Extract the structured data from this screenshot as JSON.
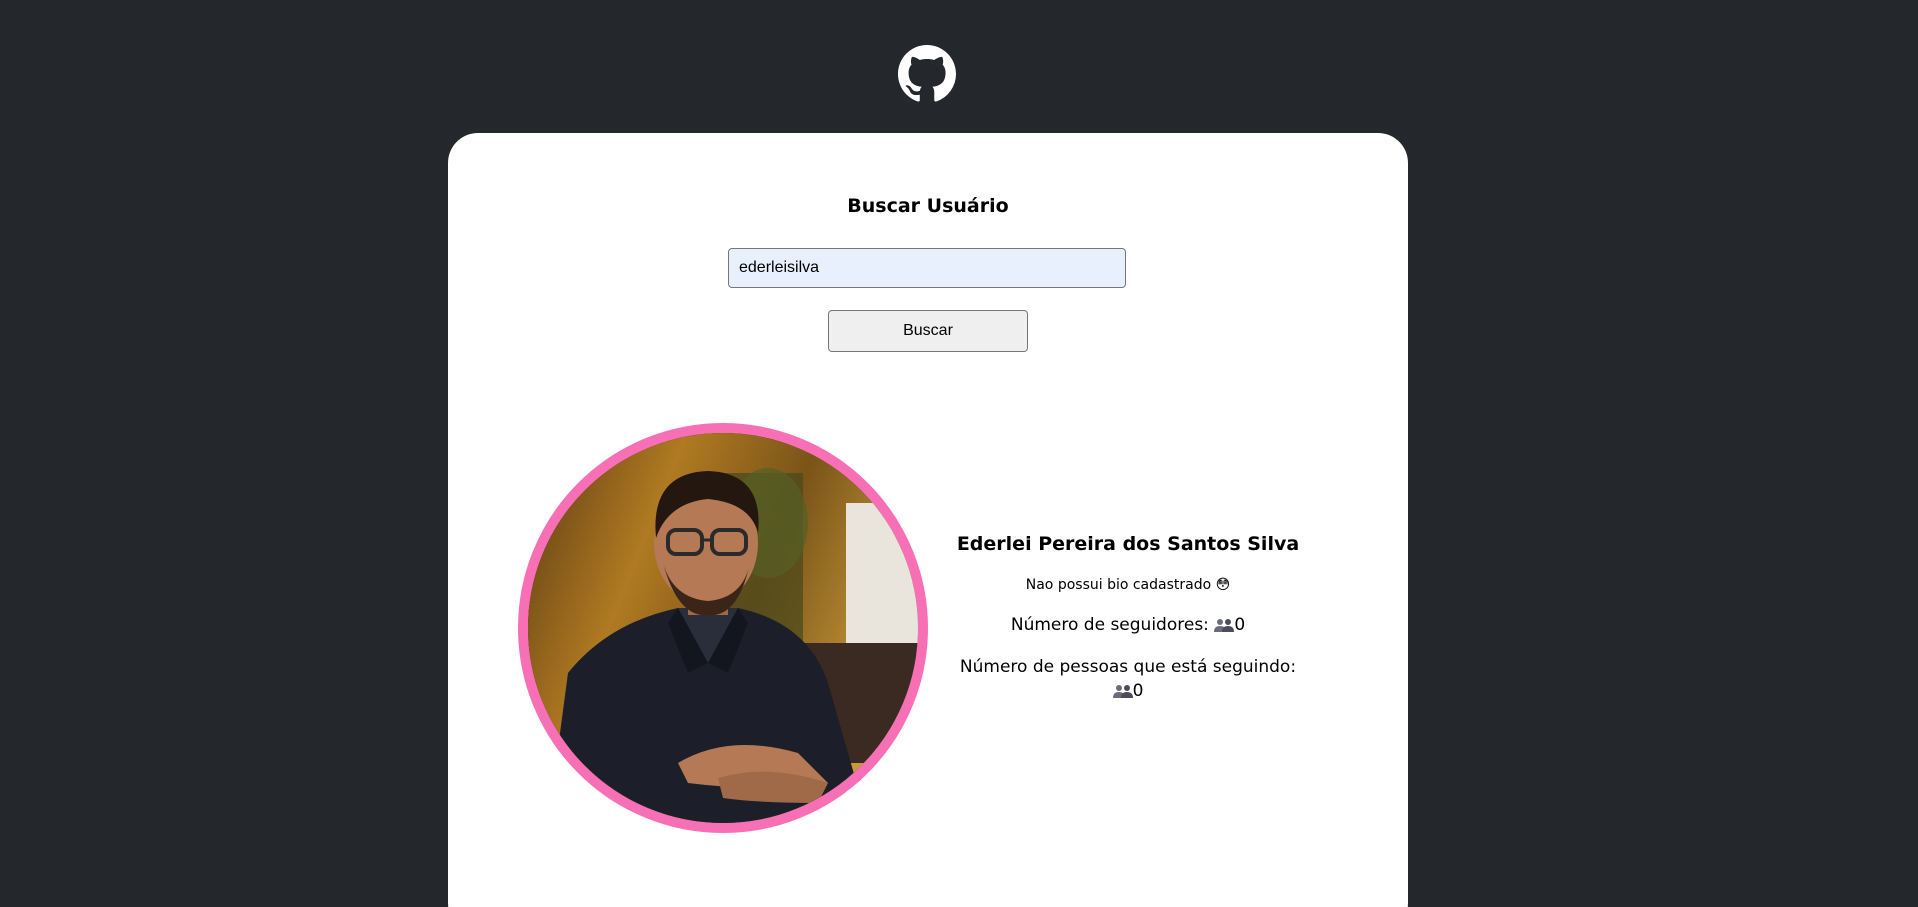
{
  "search": {
    "title": "Buscar Usuário",
    "input_value": "ederleisilva",
    "button_label": "Buscar"
  },
  "profile": {
    "name": "Ederlei Pereira dos Santos Silva",
    "bio": "Nao possui bio cadastrado 😳",
    "followers_label": "Número de seguidores:",
    "followers_count": "0",
    "following_label": "Número de pessoas que está seguindo:",
    "following_count": "0"
  },
  "icons": {
    "logo": "github-icon",
    "stats": "people-icon"
  },
  "colors": {
    "background": "#24272c",
    "card": "#ffffff",
    "avatar_border": "#f76fb5",
    "input_background": "#e8f0fe"
  }
}
